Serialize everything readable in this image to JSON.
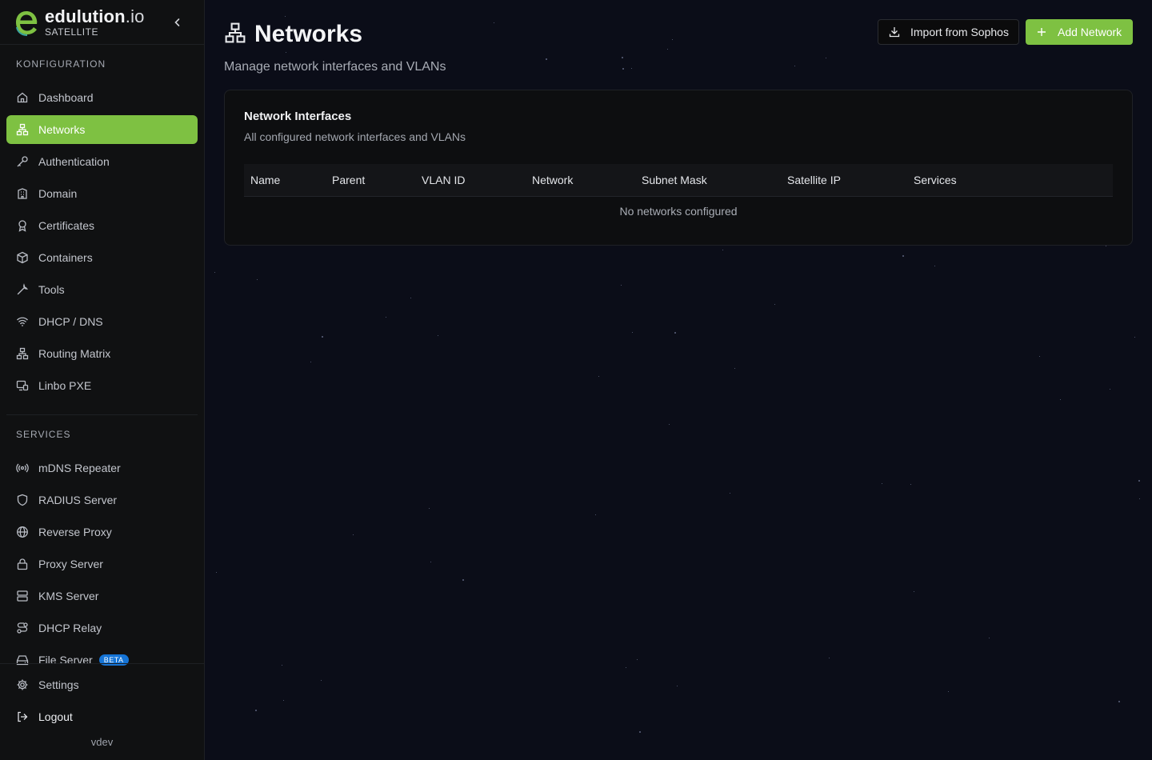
{
  "brand": {
    "name": "edulution",
    "name_suffix": ".io",
    "subtitle": "SATELLITE",
    "accent": "#7ec142"
  },
  "sidebar": {
    "sections": [
      {
        "title": "KONFIGURATION",
        "items": [
          {
            "label": "Dashboard",
            "icon": "home-icon",
            "active": false
          },
          {
            "label": "Networks",
            "icon": "network-icon",
            "active": true
          },
          {
            "label": "Authentication",
            "icon": "key-icon",
            "active": false
          },
          {
            "label": "Domain",
            "icon": "building-icon",
            "active": false
          },
          {
            "label": "Certificates",
            "icon": "award-icon",
            "active": false
          },
          {
            "label": "Containers",
            "icon": "box-icon",
            "active": false
          },
          {
            "label": "Tools",
            "icon": "wrench-icon",
            "active": false
          },
          {
            "label": "DHCP / DNS",
            "icon": "wifi-icon",
            "active": false
          },
          {
            "label": "Routing Matrix",
            "icon": "network-icon",
            "active": false
          },
          {
            "label": "Linbo PXE",
            "icon": "monitor-icon",
            "active": false
          }
        ]
      },
      {
        "title": "SERVICES",
        "items": [
          {
            "label": "mDNS Repeater",
            "icon": "radio-icon"
          },
          {
            "label": "RADIUS Server",
            "icon": "shield-icon"
          },
          {
            "label": "Reverse Proxy",
            "icon": "globe-icon"
          },
          {
            "label": "Proxy Server",
            "icon": "lock-icon"
          },
          {
            "label": "KMS Server",
            "icon": "server-icon"
          },
          {
            "label": "DHCP Relay",
            "icon": "route-icon"
          },
          {
            "label": "File Server",
            "icon": "hard-drive-icon",
            "badge": "BETA"
          }
        ]
      }
    ],
    "footer": {
      "settings": "Settings",
      "logout": "Logout",
      "version": "vdev"
    }
  },
  "page": {
    "title": "Networks",
    "description": "Manage network interfaces and VLANs",
    "actions": {
      "import_label": "Import from Sophos",
      "add_label": "Add Network"
    }
  },
  "card": {
    "title": "Network Interfaces",
    "description": "All configured network interfaces and VLANs",
    "columns": [
      "Name",
      "Parent",
      "VLAN ID",
      "Network",
      "Subnet Mask",
      "Satellite IP",
      "Services"
    ],
    "empty_message": "No networks configured"
  }
}
